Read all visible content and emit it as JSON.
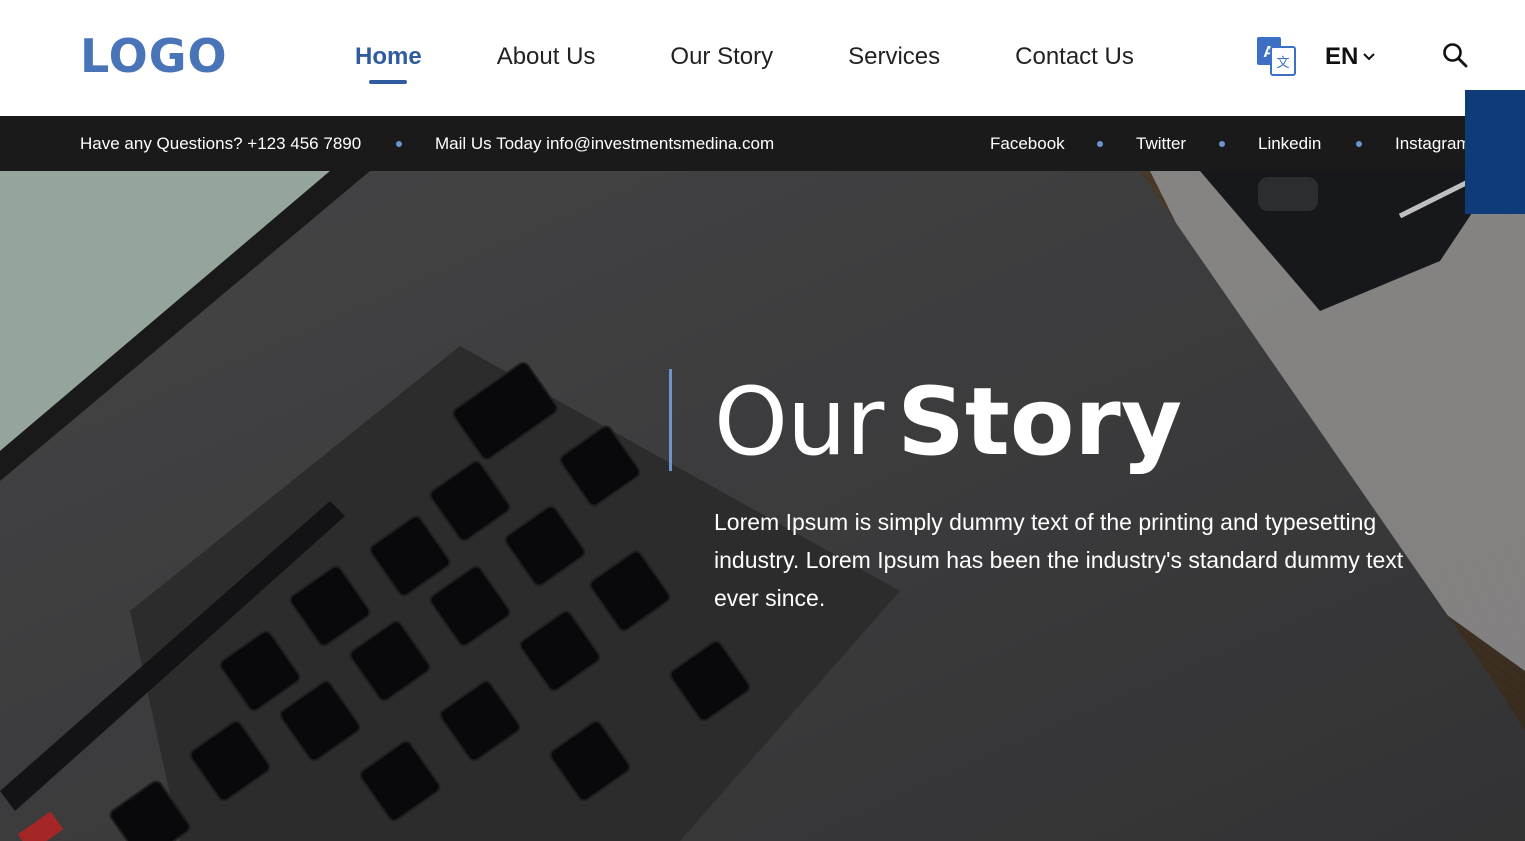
{
  "header": {
    "logo": "LOGO",
    "nav": [
      {
        "label": "Home",
        "active": true
      },
      {
        "label": "About Us",
        "active": false
      },
      {
        "label": "Our Story",
        "active": false
      },
      {
        "label": "Services",
        "active": false
      },
      {
        "label": "Contact Us",
        "active": false
      }
    ],
    "language": "EN",
    "icons": {
      "translate": "translate-icon",
      "dropdown": "chevron-down-icon",
      "search": "search-icon"
    }
  },
  "topbar": {
    "phone_text": "Have any Questions? +123 456 7890",
    "mail_text": "Mail Us Today info@investmentsmedina.com",
    "social": [
      "Facebook",
      "Twitter",
      "Linkedin",
      "Instagram"
    ]
  },
  "hero": {
    "title_light": "Our",
    "title_bold": "Story",
    "description": "Lorem Ipsum is simply dummy text of the printing and typesetting industry. Lorem Ipsum has been the industry's standard dummy text ever since."
  },
  "colors": {
    "brand": "#4a74b8",
    "nav_active": "#2f5c9e",
    "topbar_bg": "#1a1a1a",
    "accent_dot": "#6f93cf",
    "side_block": "#0f3b78"
  }
}
